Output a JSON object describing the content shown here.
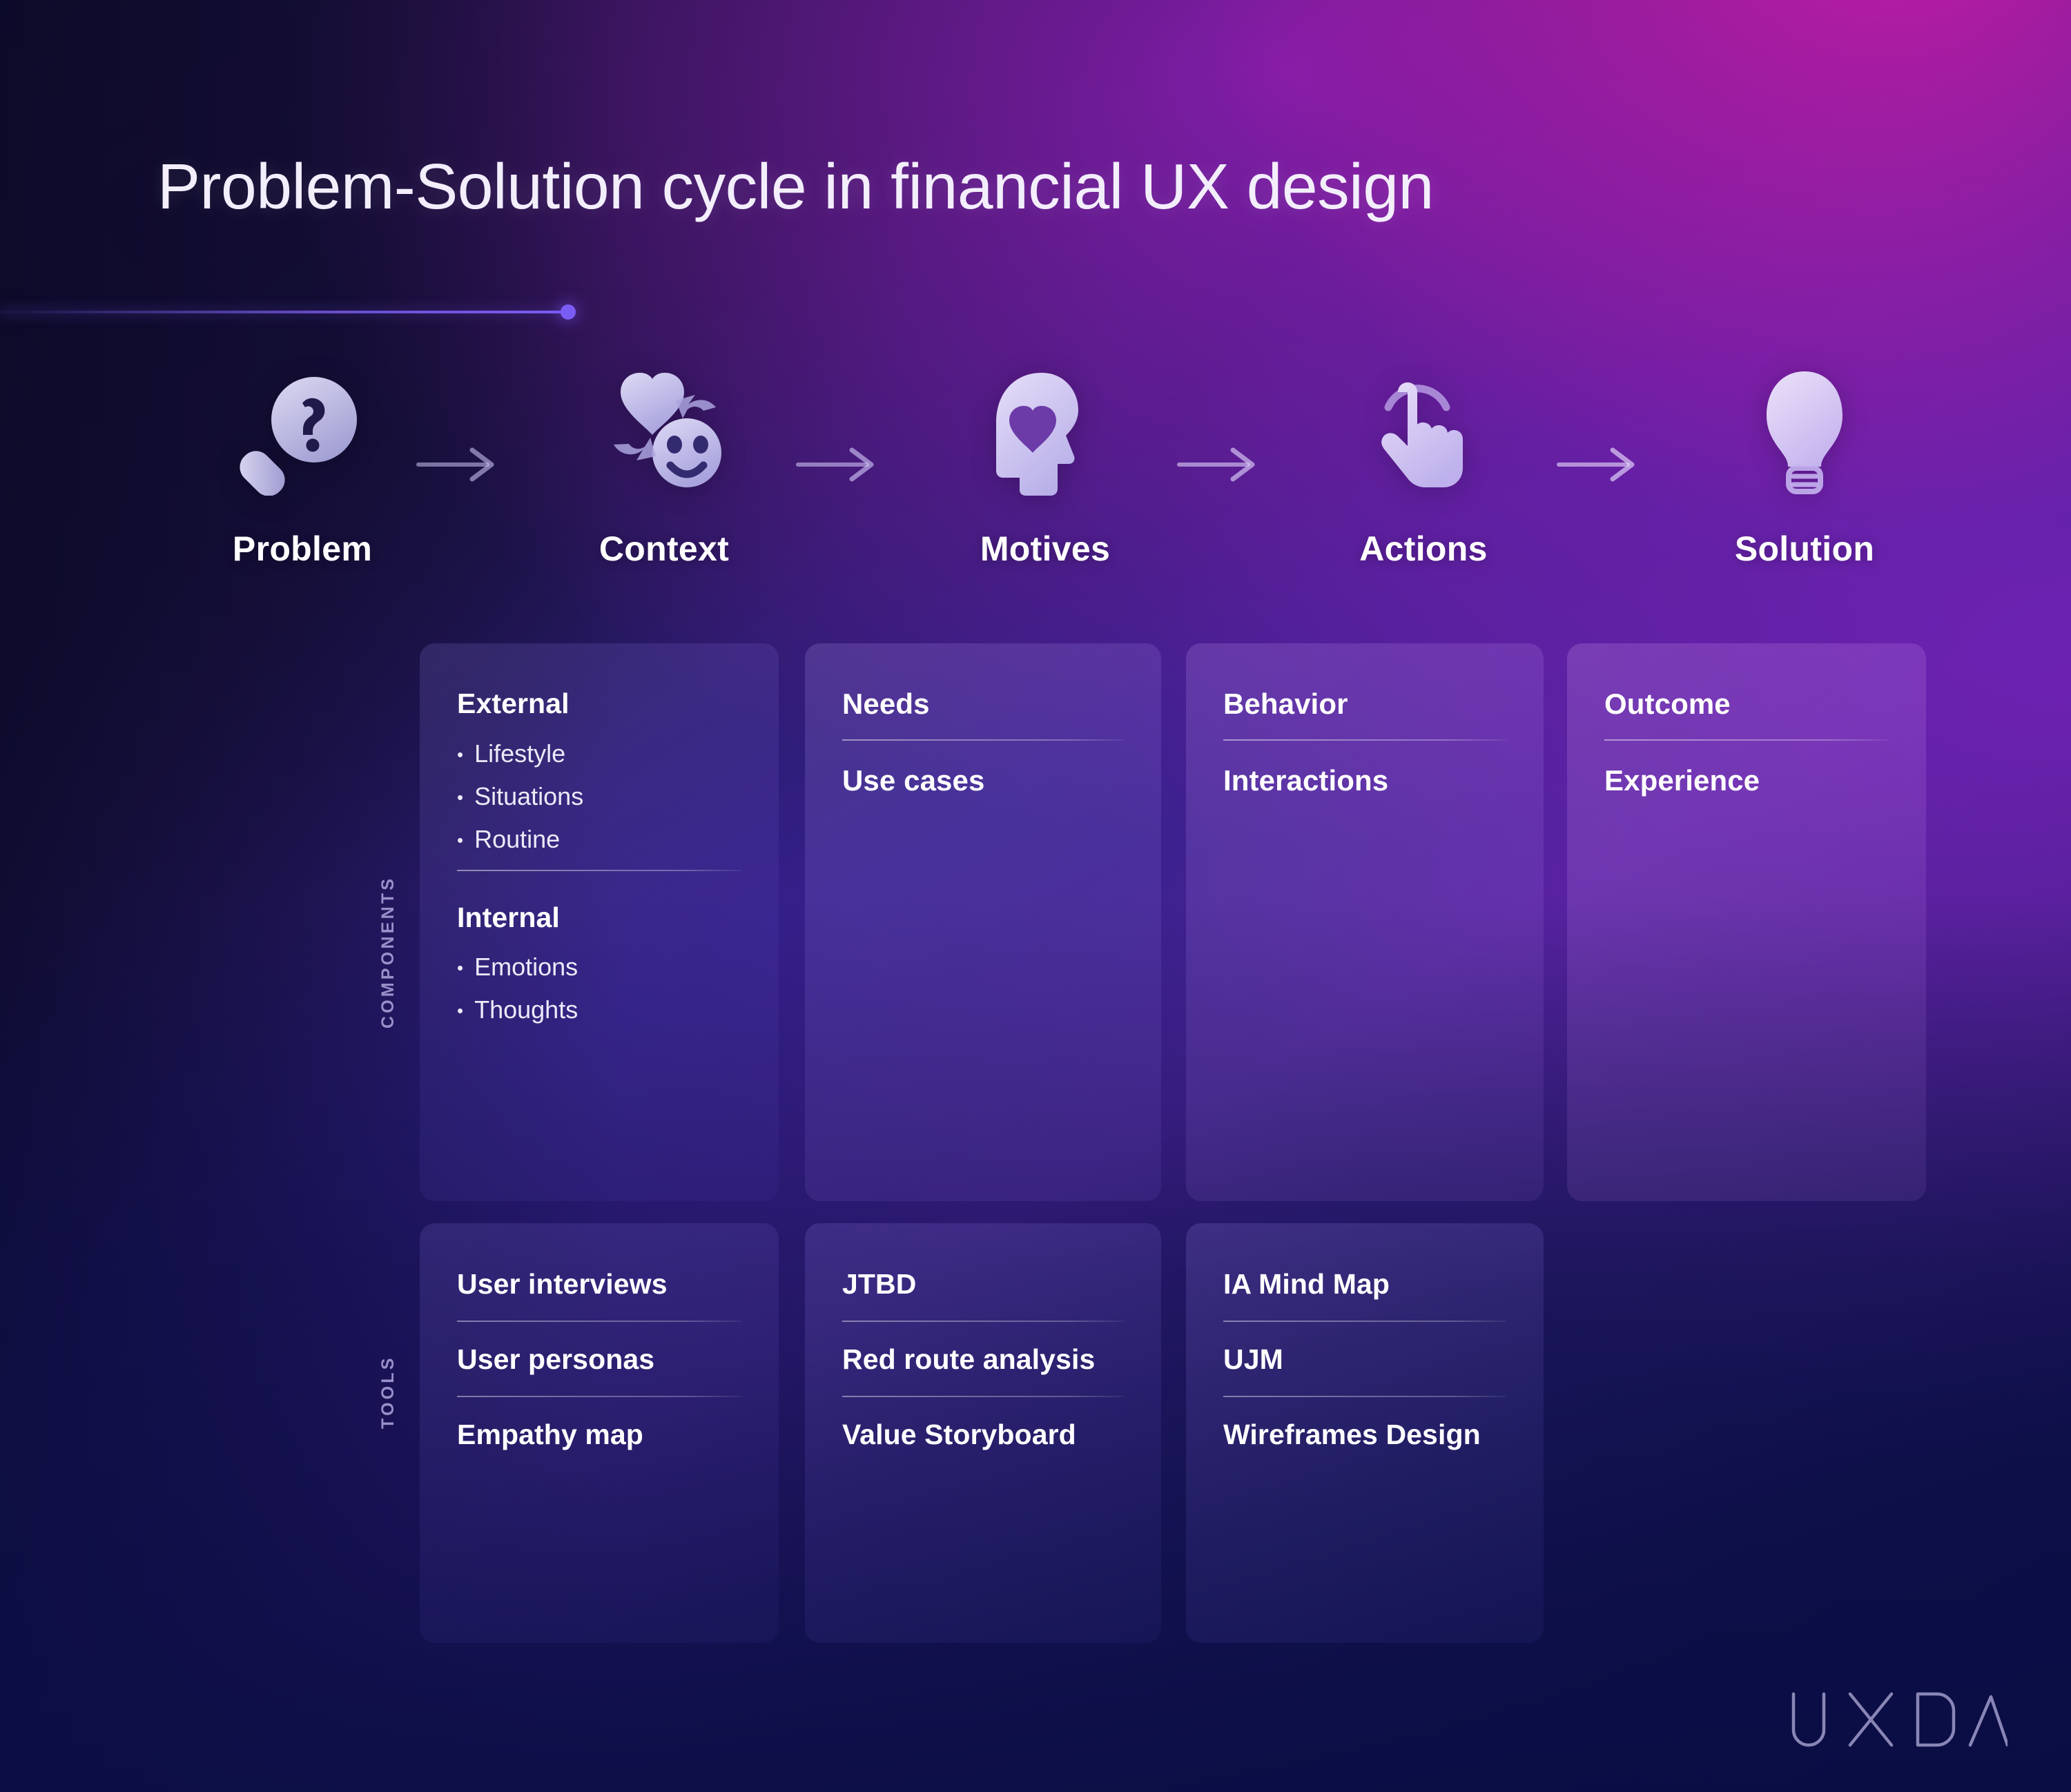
{
  "title": "Problem-Solution cycle in financial UX design",
  "brand": {
    "logo_text": "UXDA",
    "accent_color": "#7b5cf5",
    "card_text_color": "#ffffff",
    "axis_label_color": "#9a90c9"
  },
  "axis_labels": {
    "components": "COMPONENTS",
    "tools": "TOOLS"
  },
  "stages": [
    {
      "label": "Problem",
      "icon": "magnifier-question-icon"
    },
    {
      "label": "Context",
      "icon": "heart-smiley-exchange-icon"
    },
    {
      "label": "Motives",
      "icon": "head-heart-icon"
    },
    {
      "label": "Actions",
      "icon": "tap-finger-icon"
    },
    {
      "label": "Solution",
      "icon": "lightbulb-icon"
    }
  ],
  "arrows": [
    {
      "icon": "arrow-right-icon"
    },
    {
      "icon": "arrow-right-icon"
    },
    {
      "icon": "arrow-right-icon"
    },
    {
      "icon": "arrow-right-icon"
    }
  ],
  "components": {
    "context": {
      "external_heading": "External",
      "external_items": [
        "Lifestyle",
        "Situations",
        "Routine"
      ],
      "internal_heading": "Internal",
      "internal_items": [
        "Emotions",
        "Thoughts"
      ]
    },
    "motives": {
      "item1": "Needs",
      "item2": "Use cases"
    },
    "actions": {
      "item1": "Behavior",
      "item2": "Interactions"
    },
    "solution": {
      "item1": "Outcome",
      "item2": "Experience"
    }
  },
  "tools": {
    "context": {
      "item1": "User interviews",
      "item2": "User personas",
      "item3": "Empathy map"
    },
    "motives": {
      "item1": "JTBD",
      "item2": "Red route analysis",
      "item3": "Value Storyboard"
    },
    "actions": {
      "item1": "IA Mind Map",
      "item2": "UJM",
      "item3": "Wireframes Design"
    }
  },
  "bullet_glyph": "•"
}
